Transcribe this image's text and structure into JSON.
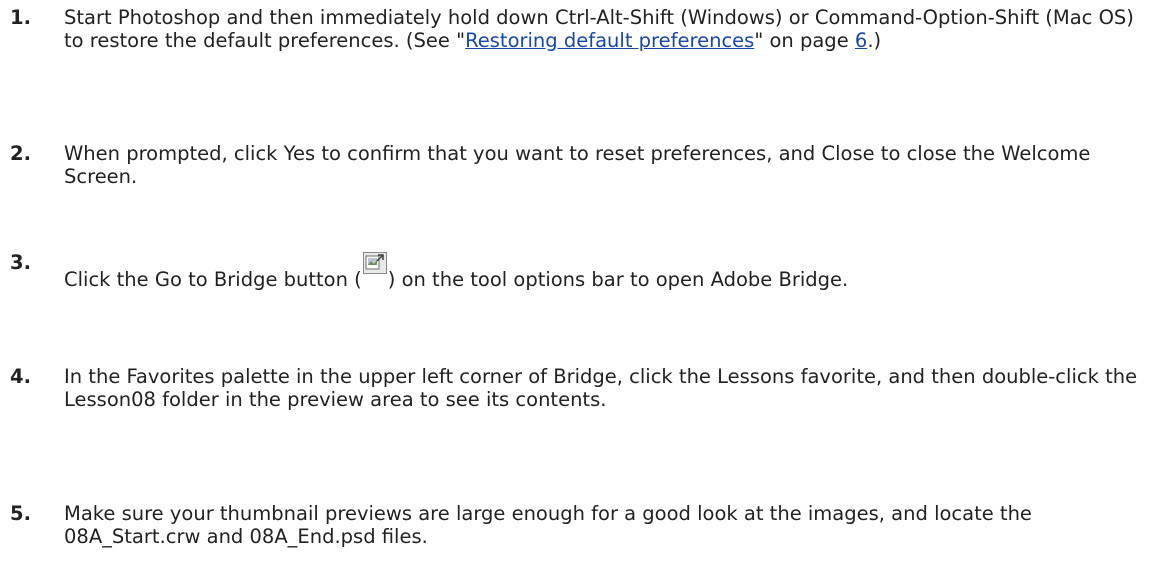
{
  "steps": [
    {
      "number": "1.",
      "text_before_link": "Start Photoshop and then immediately hold down Ctrl-Alt-Shift (Windows) or Command-Option-Shift (Mac OS) to restore the default preferences. (See \"",
      "link_text": "Restoring default preferences",
      "text_mid": "\" on page ",
      "page_link_text": "6",
      "text_after": ".)"
    },
    {
      "number": "2.",
      "text": "When prompted, click Yes to confirm that you want to reset preferences, and Close to close the Welcome Screen."
    },
    {
      "number": "3.",
      "text_before_icon": "Click the Go to Bridge button (",
      "icon_name": "go-to-bridge-icon",
      "text_after_icon": ") on the tool options bar to open Adobe Bridge."
    },
    {
      "number": "4.",
      "text": "In the Favorites palette in the upper left corner of Bridge, click the Lessons favorite, and then double-click the Lesson08 folder in the preview area to see its contents."
    },
    {
      "number": "5.",
      "text": "Make sure your thumbnail previews are large enough for a good look at the images, and locate the 08A_Start.crw and 08A_End.psd files."
    }
  ],
  "colors": {
    "text": "#222222",
    "link": "#1a47a6"
  }
}
